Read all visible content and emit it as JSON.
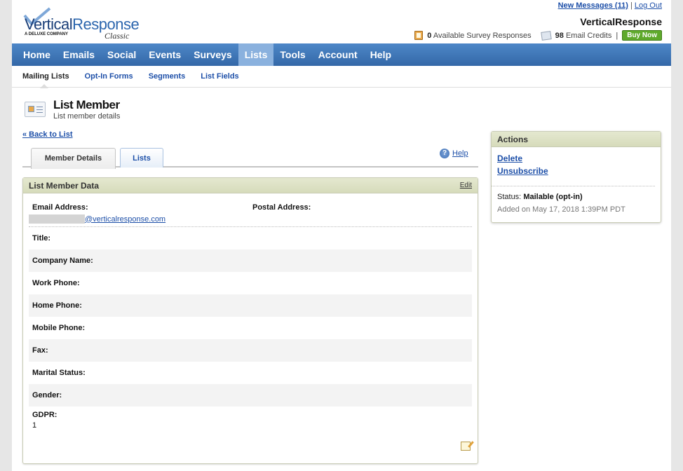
{
  "header": {
    "logo": {
      "brand_part1": "Vertical",
      "brand_part2": "Response",
      "tagline": "A DELUXE COMPANY",
      "edition": "Classic"
    },
    "new_messages_link": "New Messages (11)",
    "separator": "|",
    "logout_link": "Log Out",
    "account_name": "VerticalResponse",
    "survey_count": "0",
    "survey_label": "Available Survey Responses",
    "credits_count": "98",
    "credits_label": "Email Credits",
    "credits_separator": "|",
    "buy_now_label": "Buy Now"
  },
  "nav": {
    "items": [
      "Home",
      "Emails",
      "Social",
      "Events",
      "Surveys",
      "Lists",
      "Tools",
      "Account",
      "Help"
    ],
    "active": "Lists"
  },
  "subnav": {
    "items": [
      "Mailing Lists",
      "Opt-In Forms",
      "Segments",
      "List Fields"
    ],
    "active": "Mailing Lists"
  },
  "page": {
    "title": "List Member",
    "subtitle": "List member details",
    "back_link": "« Back to List",
    "help_label": "Help",
    "help_glyph": "?"
  },
  "tabs": [
    {
      "label": "Member Details",
      "active": true
    },
    {
      "label": "Lists",
      "active": false
    }
  ],
  "member_panel": {
    "title": "List Member Data",
    "edit_label": "Edit",
    "email_label": "Email Address:",
    "email_domain": "@verticalresponse.com",
    "postal_label": "Postal Address:",
    "fields": [
      {
        "label": "Title:",
        "value": ""
      },
      {
        "label": "Company Name:",
        "value": ""
      },
      {
        "label": "Work Phone:",
        "value": ""
      },
      {
        "label": "Home Phone:",
        "value": ""
      },
      {
        "label": "Mobile Phone:",
        "value": ""
      },
      {
        "label": "Fax:",
        "value": ""
      },
      {
        "label": "Marital Status:",
        "value": ""
      },
      {
        "label": "Gender:",
        "value": ""
      }
    ],
    "gdpr_label": "GDPR:",
    "gdpr_value": "1"
  },
  "actions_panel": {
    "title": "Actions",
    "delete_label": "Delete",
    "unsubscribe_label": "Unsubscribe",
    "status_prefix": "Status:",
    "status_value": "Mailable (opt-in)",
    "added_on": "Added on May 17, 2018 1:39PM PDT"
  },
  "icons": {
    "survey": "survey-icon",
    "credits": "email-credits-icon",
    "member": "member-card-icon",
    "help": "help-icon",
    "note": "edit-note-icon"
  },
  "colors": {
    "nav_bg": "#3f78bb",
    "nav_active": "#8ab1de",
    "link": "#1d4fa8",
    "panel_head": "#dde2c4",
    "buy_button": "#5ea92b"
  }
}
